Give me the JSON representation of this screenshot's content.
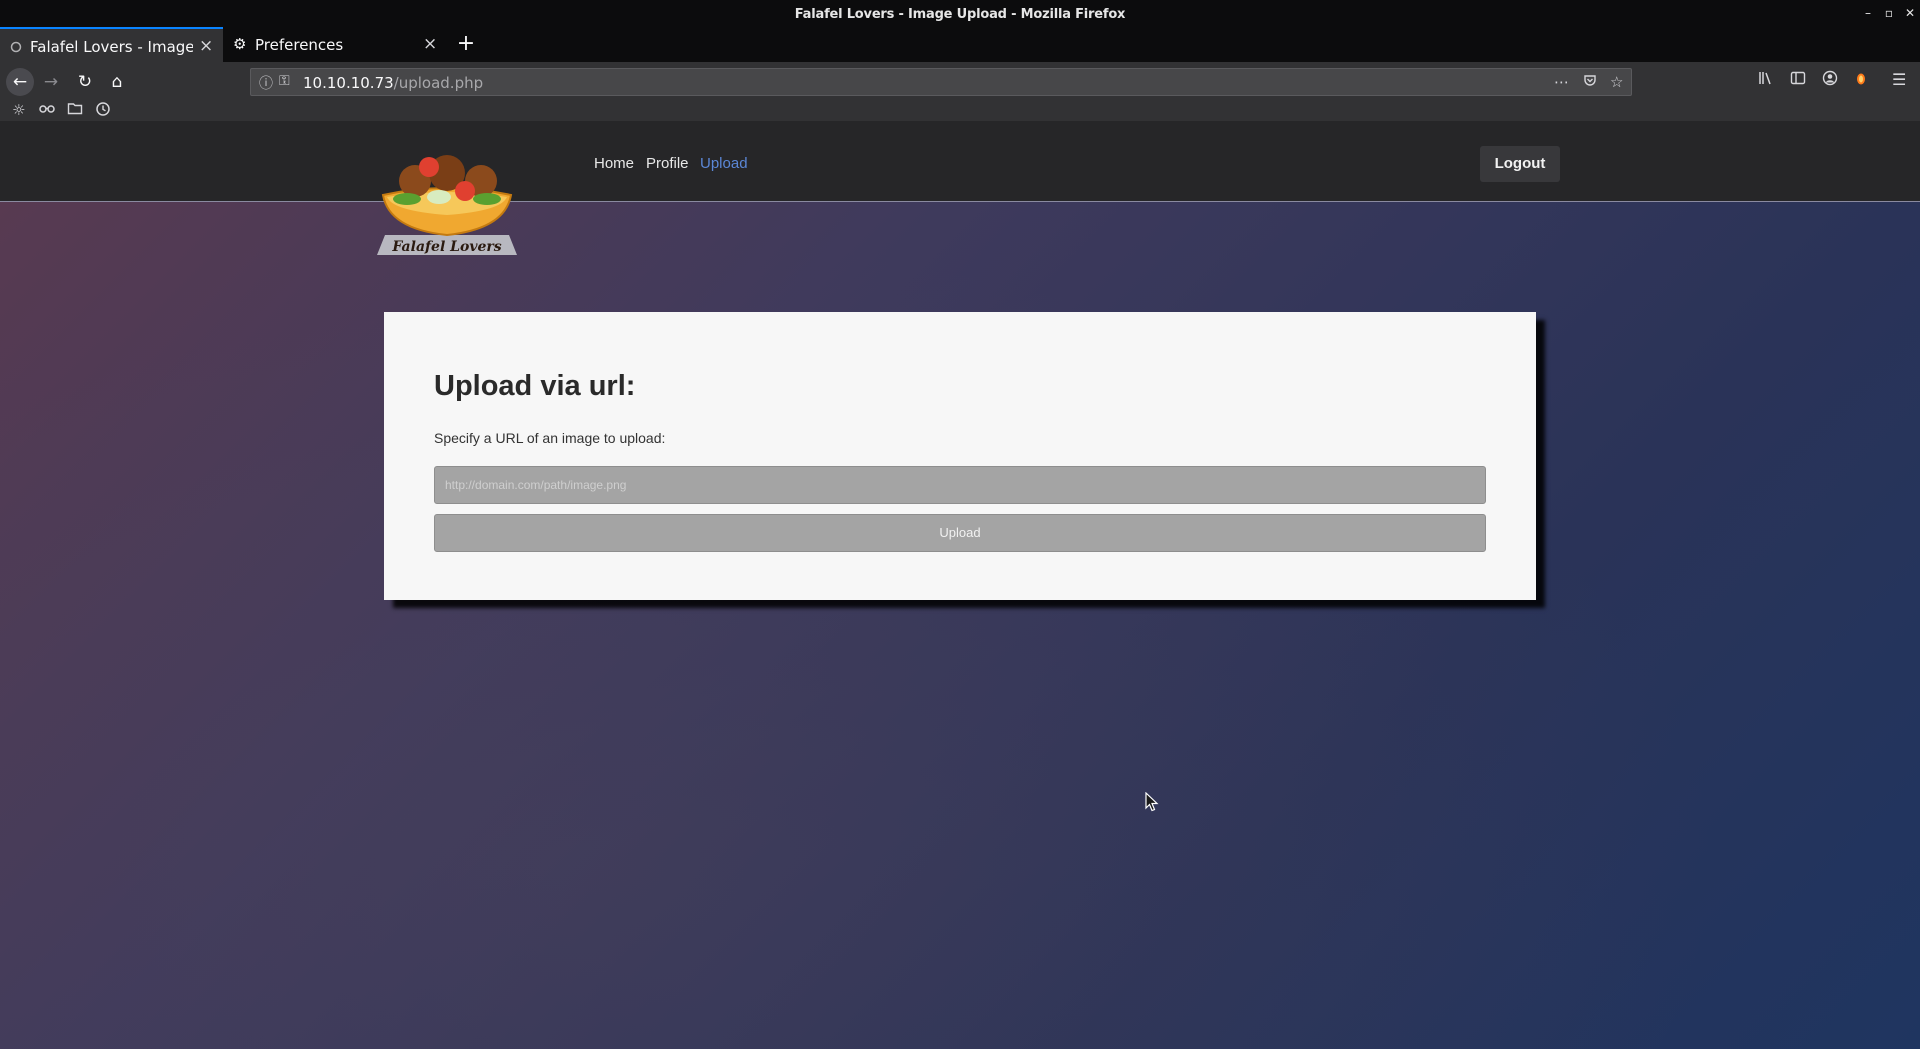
{
  "window": {
    "title": "Falafel Lovers - Image Upload - Mozilla Firefox",
    "controls": [
      "–",
      "▫",
      "✕"
    ]
  },
  "tabs": [
    {
      "label": "Falafel Lovers - Image Up",
      "active": true
    },
    {
      "label": "Preferences",
      "active": false
    }
  ],
  "newtab_label": "+",
  "urlbar": {
    "host": "10.10.10.73",
    "path": "/upload.php"
  },
  "site": {
    "logo_text": "Falafel Lovers",
    "nav": [
      "Home",
      "Profile",
      "Upload"
    ],
    "active_nav": "Upload",
    "logout_label": "Logout"
  },
  "upload_card": {
    "heading": "Upload via url:",
    "description": "Specify a URL of an image to upload:",
    "url_placeholder": "http://domain.com/path/image.png",
    "url_value": "",
    "button_label": "Upload"
  },
  "colors": {
    "accent": "#0a84ff",
    "active_link": "#5b87d6",
    "card_bg": "#f7f7f7"
  },
  "icons": {
    "back": "arrow-left-icon",
    "forward": "arrow-right-icon",
    "reload": "reload-icon",
    "home": "home-icon",
    "info": "info-icon",
    "key": "key-icon",
    "more": "ellipsis-icon",
    "pocket": "pocket-icon",
    "bookmark": "star-icon",
    "library": "library-icon",
    "sidebar": "sidebar-icon",
    "account": "account-icon",
    "extension": "extension-icon",
    "menu": "hamburger-menu-icon",
    "bookmark_toolbar": [
      "gear-icon",
      "glasses-icon",
      "folder-icon",
      "clock-icon"
    ]
  }
}
